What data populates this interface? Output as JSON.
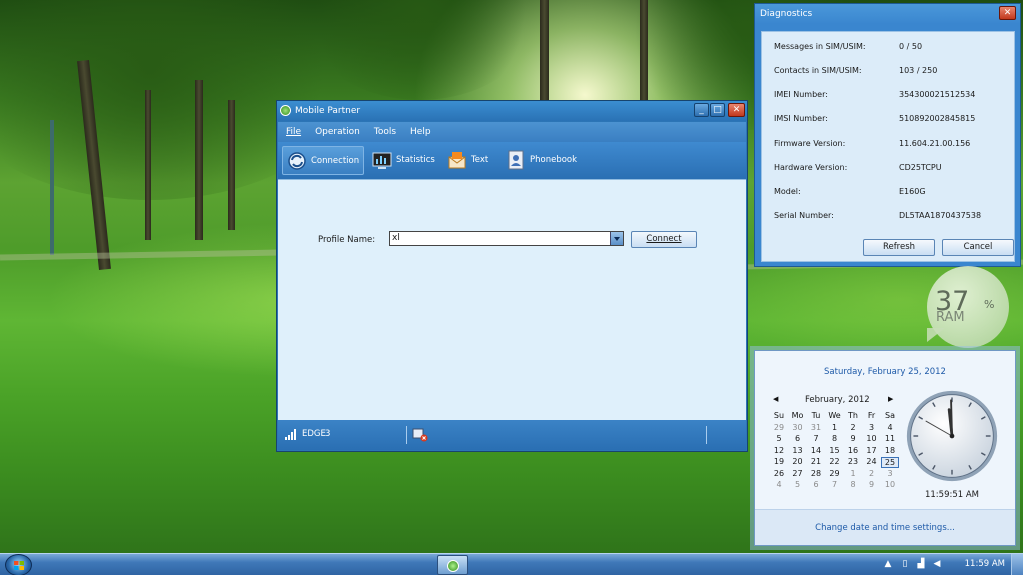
{
  "mobile_partner": {
    "title": "Mobile Partner",
    "menu": [
      "File",
      "Operation",
      "Tools",
      "Help"
    ],
    "toolbar": [
      "Connection",
      "Statistics",
      "Text",
      "Phonebook"
    ],
    "profile_label": "Profile Name:",
    "profile_value": "xl",
    "connect_label": "Connect",
    "status_network": "EDGE",
    "status_signal": "3"
  },
  "diagnostics": {
    "title": "Diagnostics",
    "rows": [
      {
        "label": "Messages in SIM/USIM:",
        "value": "0 / 50"
      },
      {
        "label": "Contacts in SIM/USIM:",
        "value": "103 / 250"
      },
      {
        "label": "IMEI Number:",
        "value": "354300021512534"
      },
      {
        "label": "IMSI Number:",
        "value": "510892002845815"
      },
      {
        "label": "Firmware Version:",
        "value": "11.604.21.00.156"
      },
      {
        "label": "Hardware Version:",
        "value": "CD25TCPU"
      },
      {
        "label": "Model:",
        "value": "E160G"
      },
      {
        "label": "Serial Number:",
        "value": "DL5TAA1870437538"
      }
    ],
    "refresh_label": "Refresh",
    "cancel_label": "Cancel"
  },
  "ram_gadget": {
    "value": "37",
    "unit": "%",
    "label": "RAM"
  },
  "calendar": {
    "full_date": "Saturday, February 25, 2012",
    "month": "February, 2012",
    "weekdays": [
      "Su",
      "Mo",
      "Tu",
      "We",
      "Th",
      "Fr",
      "Sa"
    ],
    "weeks": [
      [
        "29",
        "30",
        "31",
        "1",
        "2",
        "3",
        "4"
      ],
      [
        "5",
        "6",
        "7",
        "8",
        "9",
        "10",
        "11"
      ],
      [
        "12",
        "13",
        "14",
        "15",
        "16",
        "17",
        "18"
      ],
      [
        "19",
        "20",
        "21",
        "22",
        "23",
        "24",
        "25"
      ],
      [
        "26",
        "27",
        "28",
        "29",
        "1",
        "2",
        "3"
      ],
      [
        "4",
        "5",
        "6",
        "7",
        "8",
        "9",
        "10"
      ]
    ],
    "today": "25",
    "clock_time": "11:59:51 AM",
    "settings_link": "Change date and time settings..."
  },
  "taskbar": {
    "clock": "11:59 AM"
  },
  "colors": {
    "window_blue": "#2c75b6",
    "content_bg": "#dff0fb",
    "link_blue": "#1e5aa8"
  }
}
